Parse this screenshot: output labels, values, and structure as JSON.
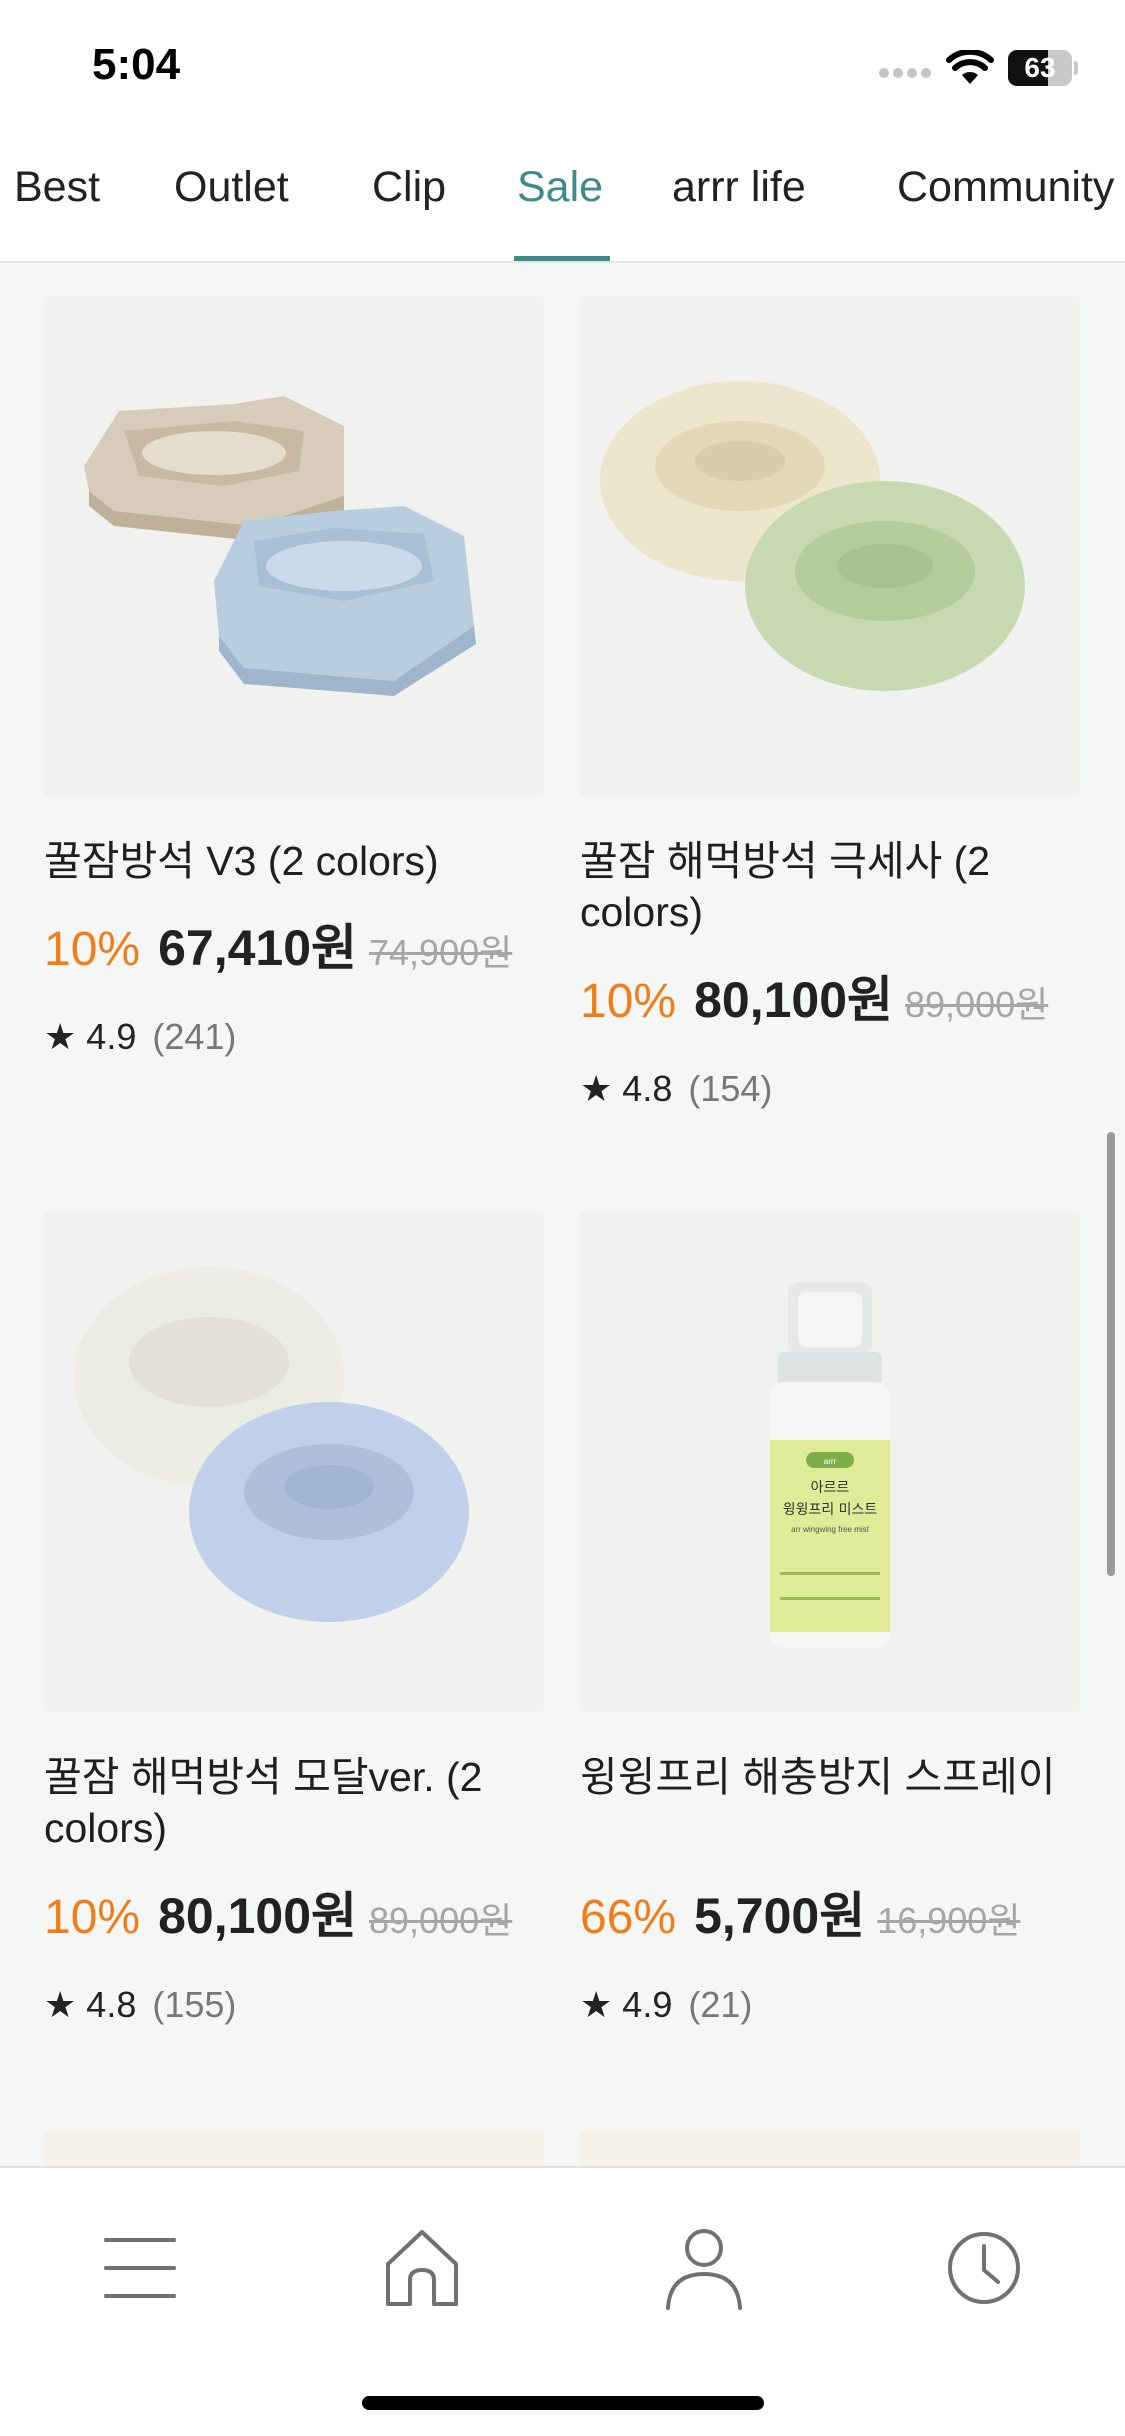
{
  "status_bar": {
    "time": "5:04",
    "battery": "63",
    "battery_level": 0.63
  },
  "tabs": [
    {
      "label": "Best"
    },
    {
      "label": "Outlet"
    },
    {
      "label": "Clip"
    },
    {
      "label": "Sale",
      "active": true
    },
    {
      "label": "arrr life"
    },
    {
      "label": "Community"
    }
  ],
  "products": [
    {
      "name": "꿀잠방석 V3 (2 colors)",
      "discount": "10%",
      "price": "67,410원",
      "original_price": "74,900원",
      "rating": "4.9",
      "review_count": "(241)"
    },
    {
      "name": "꿀잠 해먹방석 극세사 (2 colors)",
      "discount": "10%",
      "price": "80,100원",
      "original_price": "89,000원",
      "rating": "4.8",
      "review_count": "(154)"
    },
    {
      "name": "꿀잠 해먹방석 모달ver. (2 colors)",
      "discount": "10%",
      "price": "80,100원",
      "original_price": "89,000원",
      "rating": "4.8",
      "review_count": "(155)"
    },
    {
      "name": "윙윙프리 해충방지 스프레이",
      "discount": "66%",
      "price": "5,700원",
      "original_price": "16,900원",
      "rating": "4.9",
      "review_count": "(21)",
      "label_text": {
        "brand": "arrr",
        "title1": "아르르",
        "title2": "윙윙프리 미스트",
        "subtitle": "arr wingwing free mist"
      }
    }
  ],
  "rating_star": "★",
  "bottom_nav": [
    {
      "icon": "menu-icon"
    },
    {
      "icon": "home-icon"
    },
    {
      "icon": "user-icon"
    },
    {
      "icon": "clock-icon"
    }
  ],
  "colors": {
    "accent": "#3f8a8c",
    "discount": "#f07d1a",
    "background": "#f4f7f6"
  }
}
